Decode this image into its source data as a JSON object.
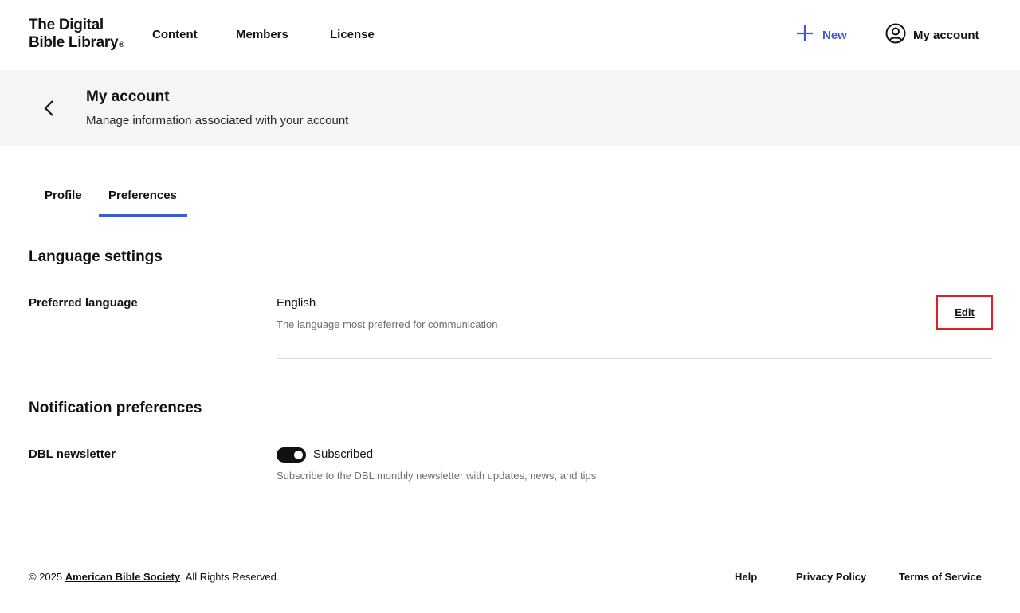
{
  "header": {
    "logo_line1": "The Digital",
    "logo_line2": "Bible Library",
    "logo_mark": "®",
    "nav": [
      {
        "label": "Content"
      },
      {
        "label": "Members"
      },
      {
        "label": "License"
      }
    ],
    "new_label": "New",
    "new_icon": "plus-icon",
    "account_label": "My account",
    "account_icon": "user-circle-icon",
    "accent_color": "#3d5bd9"
  },
  "page": {
    "title": "My account",
    "subtitle": "Manage information associated with your account",
    "back_icon": "chevron-left-icon"
  },
  "tabs": [
    {
      "label": "Profile",
      "active": false
    },
    {
      "label": "Preferences",
      "active": true
    }
  ],
  "language_settings": {
    "title": "Language settings",
    "label": "Preferred language",
    "value": "English",
    "help": "The language most preferred for communication",
    "edit_label": "Edit"
  },
  "notification_preferences": {
    "title": "Notification preferences",
    "label": "DBL newsletter",
    "toggle_state": "on",
    "toggle_label": "Subscribed",
    "help": "Subscribe to the DBL monthly newsletter with updates, news, and tips"
  },
  "footer": {
    "copyright_prefix": "© 2025 ",
    "org_link": "American Bible Society",
    "copyright_suffix": ". All Rights Reserved.",
    "links": [
      {
        "label": "Help"
      },
      {
        "label": "Privacy Policy"
      },
      {
        "label": "Terms of Service"
      }
    ]
  }
}
